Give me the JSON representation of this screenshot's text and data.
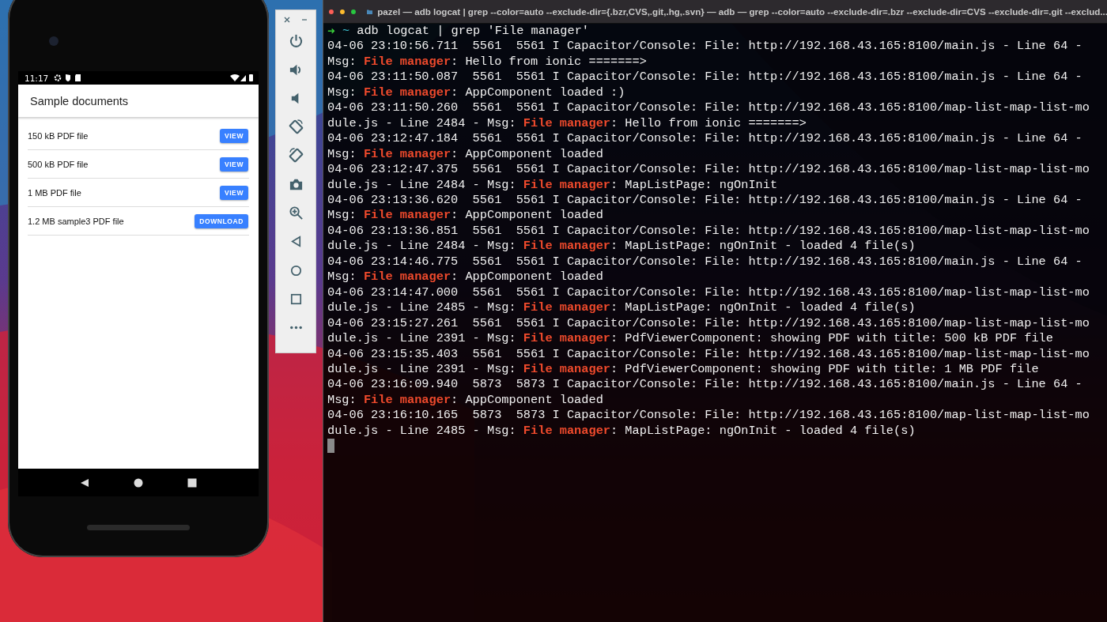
{
  "phone": {
    "status_time": "11:17",
    "app_title": "Sample documents",
    "documents": [
      {
        "name": "150 kB PDF file",
        "action": "VIEW"
      },
      {
        "name": "500 kB PDF file",
        "action": "VIEW"
      },
      {
        "name": "1 MB PDF file",
        "action": "VIEW"
      },
      {
        "name": "1.2 MB sample3 PDF file",
        "action": "DOWNLOAD"
      }
    ]
  },
  "terminal": {
    "title": "pazel — adb logcat | grep --color=auto --exclude-dir={.bzr,CVS,.git,.hg,.svn} — adb — grep --color=auto --exclude-dir=.bzr --exclude-dir=CVS --exclude-dir=.git --exclud...",
    "prompt": {
      "symbol": "➜",
      "directory": "~",
      "command": "adb logcat | grep 'File manager'"
    },
    "log": [
      "04-06 23:10:56.711  5561  5561 I Capacitor/Console: File: http://192.168.43.165:8100/main.js - Line 64 - Msg: **File manager**: Hello from ionic =======>",
      "04-06 23:11:50.087  5561  5561 I Capacitor/Console: File: http://192.168.43.165:8100/main.js - Line 64 - Msg: **File manager**: AppComponent loaded :)",
      "04-06 23:11:50.260  5561  5561 I Capacitor/Console: File: http://192.168.43.165:8100/map-list-map-list-module.js - Line 2484 - Msg: **File manager**: Hello from ionic =======>",
      "04-06 23:12:47.184  5561  5561 I Capacitor/Console: File: http://192.168.43.165:8100/main.js - Line 64 - Msg: **File manager**: AppComponent loaded",
      "04-06 23:12:47.375  5561  5561 I Capacitor/Console: File: http://192.168.43.165:8100/map-list-map-list-module.js - Line 2484 - Msg: **File manager**: MapListPage: ngOnInit",
      "04-06 23:13:36.620  5561  5561 I Capacitor/Console: File: http://192.168.43.165:8100/main.js - Line 64 - Msg: **File manager**: AppComponent loaded",
      "04-06 23:13:36.851  5561  5561 I Capacitor/Console: File: http://192.168.43.165:8100/map-list-map-list-module.js - Line 2484 - Msg: **File manager**: MapListPage: ngOnInit - loaded 4 file(s)",
      "04-06 23:14:46.775  5561  5561 I Capacitor/Console: File: http://192.168.43.165:8100/main.js - Line 64 - Msg: **File manager**: AppComponent loaded",
      "04-06 23:14:47.000  5561  5561 I Capacitor/Console: File: http://192.168.43.165:8100/map-list-map-list-module.js - Line 2485 - Msg: **File manager**: MapListPage: ngOnInit - loaded 4 file(s)",
      "04-06 23:15:27.261  5561  5561 I Capacitor/Console: File: http://192.168.43.165:8100/map-list-map-list-module.js - Line 2391 - Msg: **File manager**: PdfViewerComponent: showing PDF with title: 500 kB PDF file",
      "04-06 23:15:35.403  5561  5561 I Capacitor/Console: File: http://192.168.43.165:8100/map-list-map-list-module.js - Line 2391 - Msg: **File manager**: PdfViewerComponent: showing PDF with title: 1 MB PDF file",
      "04-06 23:16:09.940  5873  5873 I Capacitor/Console: File: http://192.168.43.165:8100/main.js - Line 64 - Msg: **File manager**: AppComponent loaded",
      "04-06 23:16:10.165  5873  5873 I Capacitor/Console: File: http://192.168.43.165:8100/map-list-map-list-module.js - Line 2485 - Msg: **File manager**: MapListPage: ngOnInit - loaded 4 file(s)"
    ]
  }
}
